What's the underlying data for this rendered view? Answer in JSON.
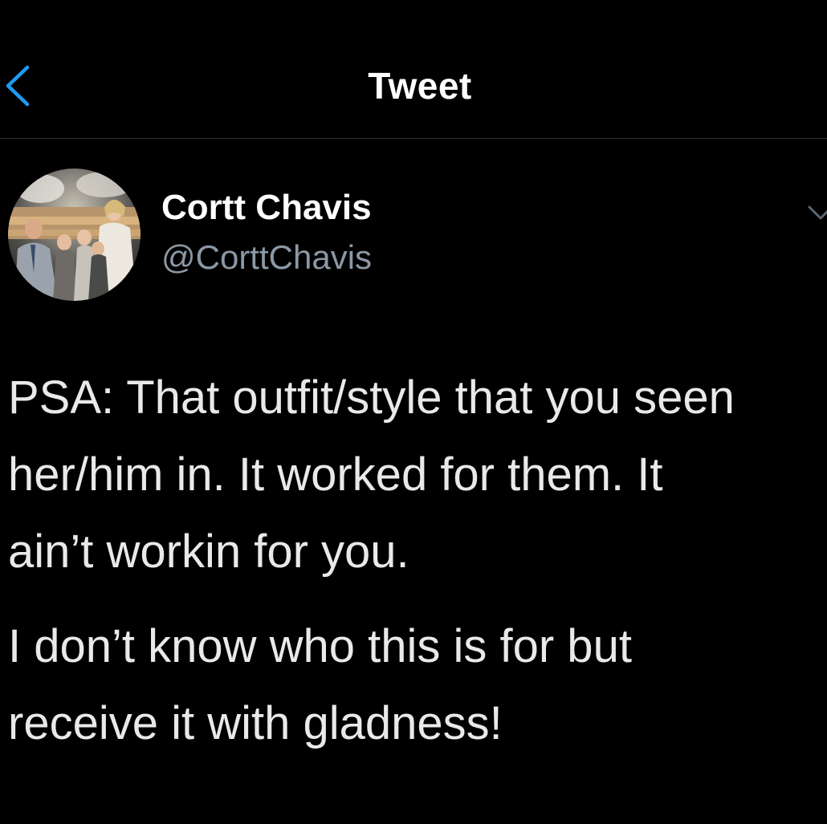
{
  "header": {
    "title": "Tweet",
    "back_icon": "chevron-left-icon",
    "accent_color": "#1d9bf0"
  },
  "author": {
    "display_name": "Cortt Chavis",
    "handle": "@CorttChavis",
    "avatar_icon": "profile-photo-avatar",
    "more_icon": "chevron-down-icon"
  },
  "tweet": {
    "paragraph_1": "PSA: That outfit/style that you seen\nher/him in. It worked for them. It\nain’t workin for you.",
    "paragraph_2": "I don’t know who this is for but\nreceive it with gladness!"
  },
  "colors": {
    "background": "#000000",
    "text": "#e7e9ea",
    "secondary_text": "#8b98a5",
    "divider": "#2f3336"
  }
}
